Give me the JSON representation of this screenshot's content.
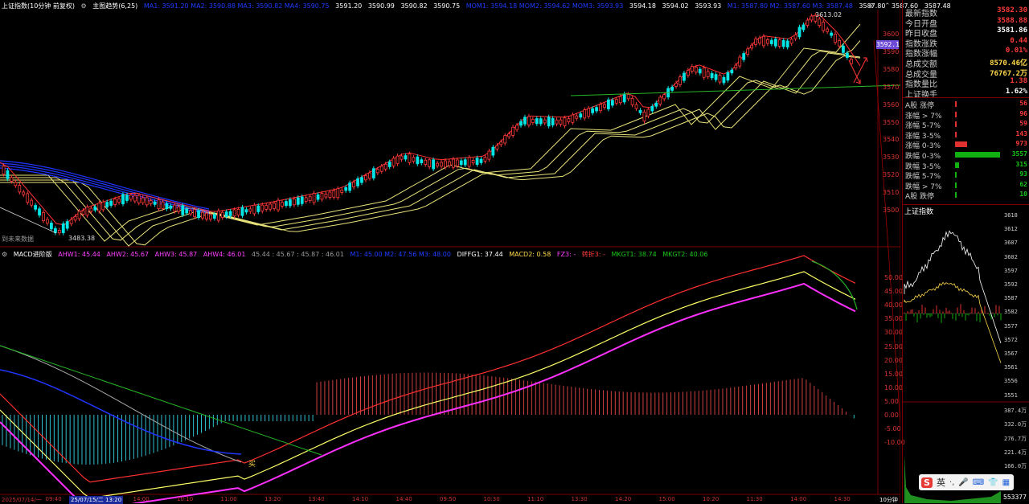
{
  "header": {
    "title": "上证指数(10分钟 前复权)",
    "indicator": "主图趋势(6,25)",
    "ma_faint": "MA1: 3591.20  MA2: 3590.88  MA3: 3590.82  MA4: 3590.75",
    "ma_values": [
      "3591.20",
      "3590.99",
      "3590.82",
      "3590.75"
    ],
    "mom_faint": "MOM1: 3594.18  MOM2: 3594.62  MOM3: 3593.93",
    "mom_values": [
      "3594.18",
      "3594.02",
      "3593.93"
    ],
    "m_faint": "M1: 3587.80  M2: 3587.60  M3: 3587.48",
    "m_values": [
      "3587.80",
      "3587.60",
      "3587.48"
    ]
  },
  "main": {
    "yticks": [
      "3600",
      "3590",
      "3580",
      "3570",
      "3560",
      "3550",
      "3540",
      "3530",
      "3520",
      "3510",
      "3500"
    ],
    "price_tag": "3592.1",
    "high_label": "3613.02",
    "low_label": "3483.38",
    "future_label": "到未来数据",
    "colors": {
      "up": "#ff3b3b",
      "down": "#00e5e5",
      "ma_yellow": "#e8e27a",
      "ma_blue": "#1e2fff",
      "trend_green": "#26b826"
    }
  },
  "macd": {
    "title": "MACD进阶版",
    "ahw": [
      "AHW1: 45.44",
      "AHW2: 45.67",
      "AHW3: 45.87",
      "AHW4: 46.01"
    ],
    "ahw_plain": "45.44 : 45.67 : 45.87 : 46.01",
    "m_faint": "M1: 45.00  M2: 47.56  M3: 48.00",
    "diff": "DIFFG1: 37.44",
    "macd2": "MACD2: 0.58",
    "fz": "FZ3: -",
    "turn": "转折3: -",
    "mkgt1": "MKGT1: 38.74",
    "mkgt2": "MKGT2: 40.06",
    "yticks": [
      "50.00",
      "45.00",
      "40.00",
      "35.00",
      "30.00",
      "25.00",
      "20.00",
      "15.00",
      "10.00",
      "5.00",
      "0.00",
      "-5.00",
      "-10.00"
    ],
    "buy_label": "买"
  },
  "xaxis": {
    "ticks": [
      "2025/07/14/一",
      "09:40",
      "13:10",
      "14:00",
      "10:10",
      "11:00",
      "13:20",
      "13:40",
      "14:10",
      "14:40",
      "09:50",
      "10:30",
      "11:10",
      "13:30",
      "14:20",
      "15:00",
      "10:20",
      "11:30",
      "14:00",
      "14:30"
    ],
    "cursor": "25/07/15/二 13:20",
    "period": "10分钟"
  },
  "quote": {
    "rows": [
      {
        "k": "最新指数",
        "v": "3582.30",
        "c": "red"
      },
      {
        "k": "今日开盘",
        "v": "3588.88",
        "c": "red"
      },
      {
        "k": "昨日收盘",
        "v": "3581.86",
        "c": "white"
      },
      {
        "k": "指数涨跌",
        "v": "0.44",
        "c": "red"
      },
      {
        "k": "指数涨幅",
        "v": "0.01%",
        "c": "red"
      },
      {
        "k": "总成交额",
        "v": "8570.46亿",
        "c": "yellow"
      },
      {
        "k": "总成交量",
        "v": "76767.2万",
        "c": "yellow"
      },
      {
        "k": "指数量比",
        "v": "1.38",
        "c": "red"
      },
      {
        "k": "上证换手",
        "v": "1.62%",
        "c": "white"
      }
    ]
  },
  "breadth": {
    "rows": [
      {
        "k": "A股 涨停",
        "v": "56",
        "c": "red",
        "bar": 0.02
      },
      {
        "k": "涨幅 > 7%",
        "v": "96",
        "c": "red",
        "bar": 0.03
      },
      {
        "k": "涨幅 5-7%",
        "v": "59",
        "c": "red",
        "bar": 0.02
      },
      {
        "k": "涨幅 3-5%",
        "v": "143",
        "c": "red",
        "bar": 0.04
      },
      {
        "k": "涨幅 0-3%",
        "v": "973",
        "c": "red",
        "bar": 0.27
      },
      {
        "k": "跌幅 0-3%",
        "v": "3557",
        "c": "green",
        "bar": 1.0
      },
      {
        "k": "跌幅 3-5%",
        "v": "315",
        "c": "green",
        "bar": 0.09
      },
      {
        "k": "跌幅 5-7%",
        "v": "93",
        "c": "green",
        "bar": 0.03
      },
      {
        "k": "跌幅 > 7%",
        "v": "62",
        "c": "green",
        "bar": 0.02
      },
      {
        "k": "A股 跌停",
        "v": "10",
        "c": "green",
        "bar": 0.01
      }
    ]
  },
  "intraday": {
    "title": "上证指数",
    "yticks": [
      "3618",
      "3612",
      "3607",
      "3602",
      "3597",
      "3592",
      "3587",
      "3582",
      "3577",
      "3572",
      "3567",
      "3561",
      "3556",
      "3551"
    ],
    "vol_ticks": [
      "387.4万",
      "332.0万",
      "276.7万",
      "221.4万",
      "166.0万"
    ],
    "vol_last": "553377"
  },
  "toolbar": {
    "input_lang": "英"
  }
}
